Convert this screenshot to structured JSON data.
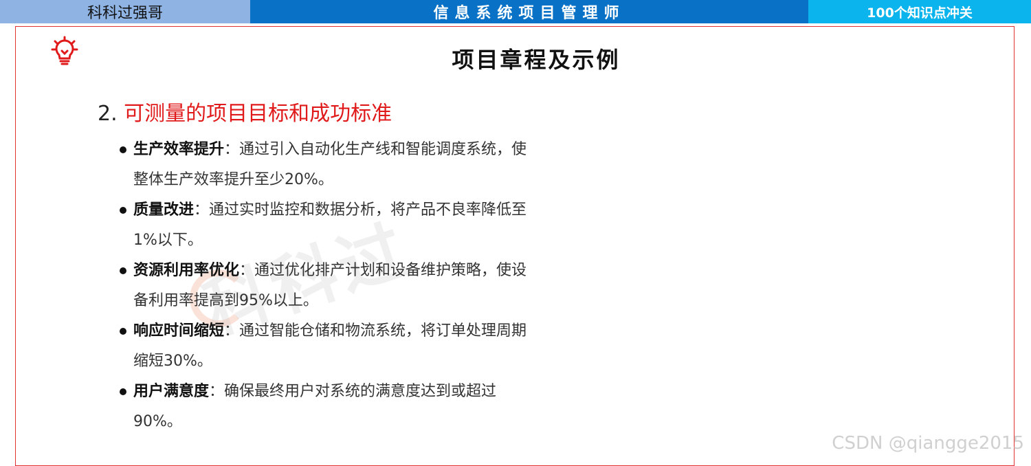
{
  "topbar": {
    "left": "科科过强哥",
    "center": "信息系统项目管理师",
    "right": "100个知识点冲关"
  },
  "title": "项目章程及示例",
  "heading": {
    "number": "2.",
    "text": "可测量的项目目标和成功标准"
  },
  "items": [
    {
      "key": "生产效率提升",
      "text": "：通过引入自动化生产线和智能调度系统，使整体生产效率提升至少20%。"
    },
    {
      "key": "质量改进",
      "text": "：通过实时监控和数据分析，将产品不良率降低至1%以下。"
    },
    {
      "key": "资源利用率优化",
      "text": "：通过优化排产计划和设备维护策略，使设备利用率提高到95%以上。"
    },
    {
      "key": "响应时间缩短",
      "text": "：通过智能仓储和物流系统，将订单处理周期缩短30%。"
    },
    {
      "key": "用户满意度",
      "text": "：确保最终用户对系统的满意度达到或超过90%。"
    }
  ],
  "watermark": "科科过",
  "credit": "CSDN @qiangge2015",
  "colors": {
    "frame": "#e03030",
    "heading_accent": "#e01a1a",
    "bar_left": "#8fb4e3",
    "bar_mid": "#0a72c6",
    "bar_right": "#0bb4ec"
  },
  "icons": {
    "bulb": "lightbulb-icon"
  }
}
